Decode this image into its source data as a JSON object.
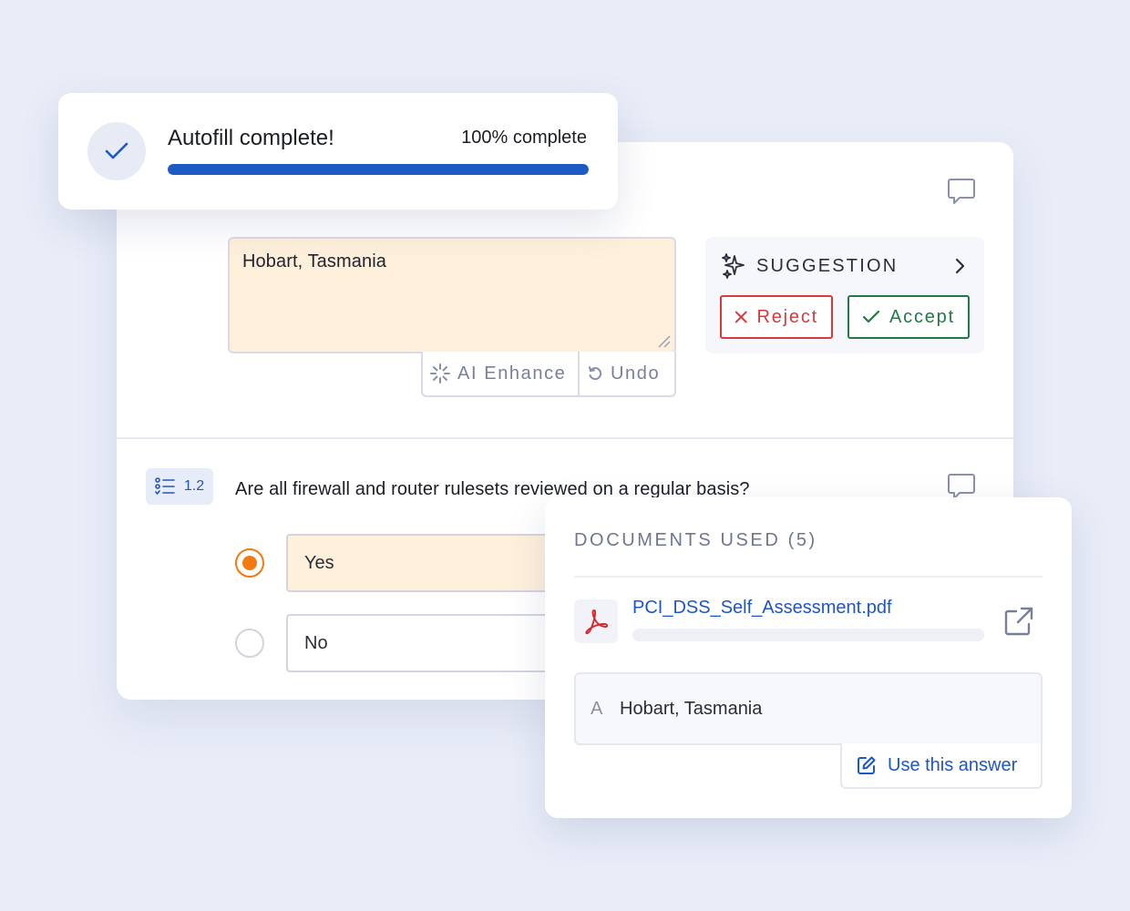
{
  "toast": {
    "title": "Autofill complete!",
    "progress_label": "100% complete",
    "progress_fraction": 1.0,
    "check_icon": "check-icon"
  },
  "question1": {
    "answer_value": "Hobart, Tasmania",
    "tools": {
      "enhance_label": "AI Enhance",
      "undo_label": "Undo"
    },
    "suggestion": {
      "label": "SUGGESTION",
      "reject_label": "Reject",
      "accept_label": "Accept"
    }
  },
  "question2": {
    "number": "1.2",
    "text": "Are all firewall and router rulesets reviewed on a regular basis?",
    "options": [
      {
        "label": "Yes",
        "selected": true
      },
      {
        "label": "No",
        "selected": false
      }
    ]
  },
  "documents": {
    "title": "DOCUMENTS USED (5)",
    "file_name": "PCI_DSS_Self_Assessment.pdf",
    "answer_letter": "A",
    "answer_text": "Hobart, Tasmania",
    "use_label": "Use this answer"
  },
  "colors": {
    "accent_blue": "#1d5bc4",
    "selected_fill": "#fff0dc",
    "radio_orange": "#f37a12",
    "reject_red": "#d63a3a",
    "accept_green": "#1f7a45"
  }
}
